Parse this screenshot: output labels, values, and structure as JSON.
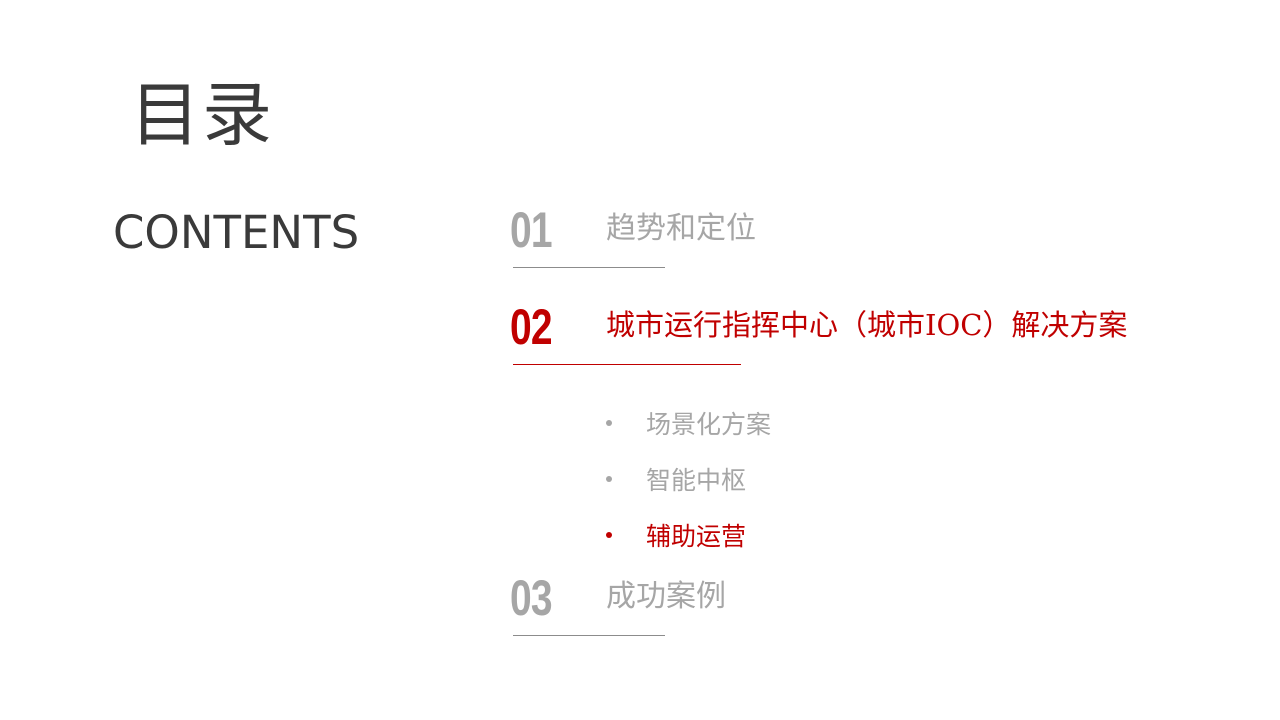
{
  "header": {
    "title_cn": "目录",
    "title_en": "CONTENTS"
  },
  "colors": {
    "accent": "#c00000",
    "inactive": "#a6a6a6",
    "text_dark": "#3a3a3a"
  },
  "sections": [
    {
      "number": "01",
      "label": "趋势和定位",
      "active": false
    },
    {
      "number": "02",
      "label": "城市运行指挥中心（城市IOC）解决方案",
      "active": true,
      "subitems": [
        {
          "label": "场景化方案",
          "active": false
        },
        {
          "label": "智能中枢",
          "active": false
        },
        {
          "label": "辅助运营",
          "active": true
        }
      ]
    },
    {
      "number": "03",
      "label": "成功案例",
      "active": false
    }
  ]
}
